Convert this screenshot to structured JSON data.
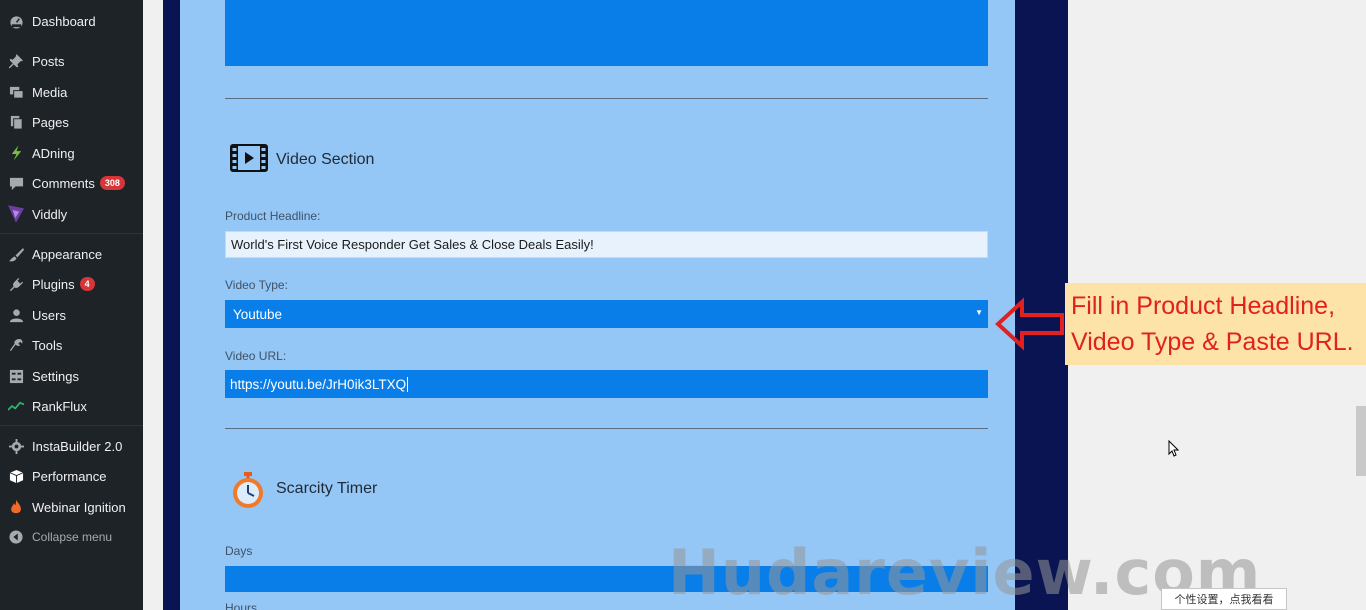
{
  "sidebar": {
    "items": [
      {
        "label": "Dashboard",
        "icon": "dashboard-icon"
      },
      {
        "label": "Posts",
        "icon": "pin-icon"
      },
      {
        "label": "Media",
        "icon": "media-icon"
      },
      {
        "label": "Pages",
        "icon": "pages-icon"
      },
      {
        "label": "ADning",
        "icon": "lightning-icon"
      },
      {
        "label": "Comments",
        "icon": "comment-icon",
        "badge": "308"
      },
      {
        "label": "Viddly",
        "icon": "viddly-icon"
      },
      {
        "label": "Appearance",
        "icon": "brush-icon"
      },
      {
        "label": "Plugins",
        "icon": "plug-icon",
        "badge": "4"
      },
      {
        "label": "Users",
        "icon": "user-icon"
      },
      {
        "label": "Tools",
        "icon": "wrench-icon"
      },
      {
        "label": "Settings",
        "icon": "settings-icon"
      },
      {
        "label": "RankFlux",
        "icon": "chart-icon"
      },
      {
        "label": "InstaBuilder 2.0",
        "icon": "gear-icon"
      },
      {
        "label": "Performance",
        "icon": "cube-icon"
      },
      {
        "label": "Webinar Ignition",
        "icon": "flame-icon"
      }
    ],
    "collapse_label": "Collapse menu"
  },
  "video_section": {
    "title": "Video Section",
    "headline_label": "Product Headline:",
    "headline_value": "World's First Voice Responder Get Sales & Close Deals Easily!",
    "type_label": "Video Type:",
    "type_value": "Youtube",
    "url_label": "Video URL:",
    "url_value": "https://youtu.be/JrH0ik3LTXQ"
  },
  "scarcity_section": {
    "title": "Scarcity Timer",
    "days_label": "Days",
    "hours_label": "Hours"
  },
  "callout": {
    "line1": "Fill in Product Headline,",
    "line2": "Video Type & Paste URL."
  },
  "watermark": "Hudareview.com",
  "ime_bar": "个性设置，点我看看",
  "colors": {
    "sidebar_bg": "#1e2327",
    "panel_bg": "#94c6f6",
    "field_blue": "#0a7ee8",
    "frame": "#0a1452",
    "callout_bg": "#fde3a7",
    "callout_text": "#e0211f"
  }
}
